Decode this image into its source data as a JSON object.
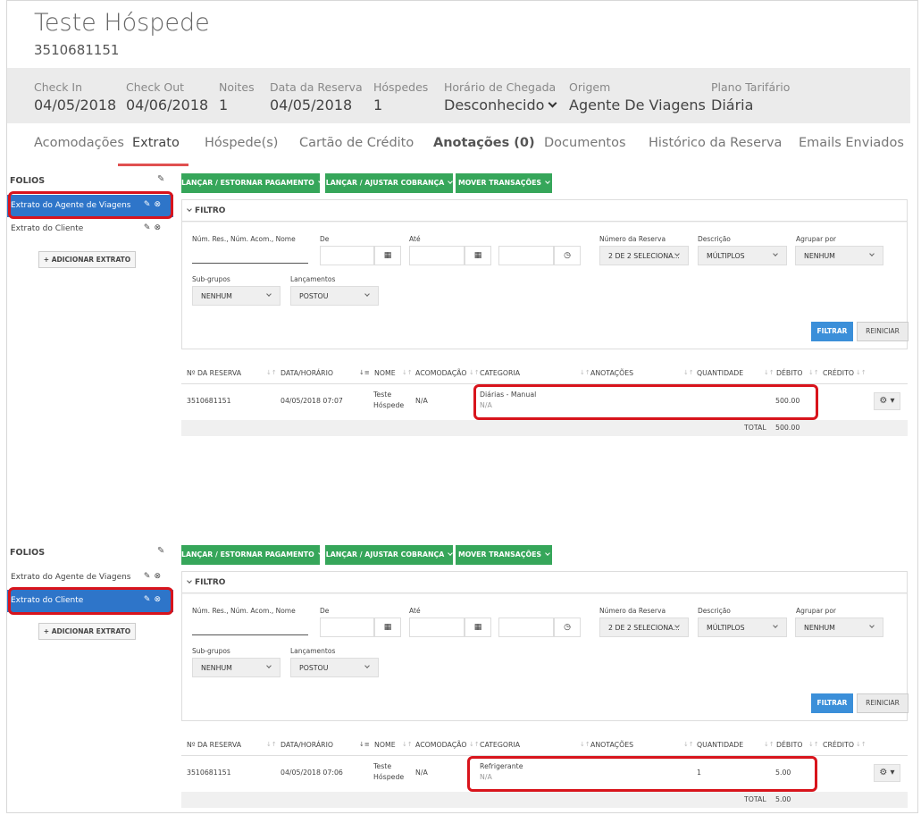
{
  "header": {
    "guest_name": "Teste Hóspede",
    "reservation_id": "3510681151"
  },
  "info": {
    "check_in": {
      "label": "Check In",
      "value": "04/05/2018"
    },
    "check_out": {
      "label": "Check Out",
      "value": "04/06/2018"
    },
    "nights": {
      "label": "Noites",
      "value": "1"
    },
    "booking_date": {
      "label": "Data da Reserva",
      "value": "04/05/2018"
    },
    "guests": {
      "label": "Hóspedes",
      "value": "1"
    },
    "arrival": {
      "label": "Horário de Chegada",
      "value": "Desconhecido"
    },
    "origin": {
      "label": "Origem",
      "value": "Agente De Viagens"
    },
    "rate_plan": {
      "label": "Plano Tarifário",
      "value": "Diária"
    }
  },
  "tabs": [
    "Acomodações",
    "Extrato",
    "Hóspede(s)",
    "Cartão de Crédito",
    "Anotações (0)",
    "Documentos",
    "Histórico da Reserva",
    "Emails Enviados"
  ],
  "sidebar": {
    "title": "FOLIOS",
    "items": [
      "Extrato do Agente de Viagens",
      "Extrato do Cliente"
    ],
    "add_button": "ADICIONAR EXTRATO"
  },
  "actions": {
    "payment": "LANÇAR / ESTORNAR PAGAMENTO",
    "charge": "LANÇAR / AJUSTAR COBRANÇA",
    "move": "MOVER TRANSAÇÕES"
  },
  "filter": {
    "title": "FILTRO",
    "search_label": "Núm. Res., Núm. Acom., Nome",
    "from_label": "De",
    "to_label": "Até",
    "reservation_label": "Número da Reserva",
    "reservation_value": "2 DE 2 SELECIONA...",
    "description_label": "Descrição",
    "description_value": "MÚLTIPLOS",
    "group_label": "Agrupar por",
    "group_value": "NENHUM",
    "subgroups_label": "Sub-grupos",
    "subgroups_value": "NENHUM",
    "entries_label": "Lançamentos",
    "entries_value": "POSTOU",
    "filter_button": "FILTRAR",
    "reset_button": "REINICIAR"
  },
  "table": {
    "columns": [
      "Nº DA RESERVA",
      "DATA/HORÁRIO",
      "NOME",
      "ACOMODAÇÃO",
      "CATEGORIA",
      "ANOTAÇÕES",
      "QUANTIDADE",
      "DÉBITO",
      "CRÉDITO"
    ],
    "total_label": "TOTAL"
  },
  "panel1": {
    "row": {
      "reservation": "3510681151",
      "datetime": "04/05/2018 07:07",
      "name_line1": "Teste",
      "name_line2": "Hóspede",
      "room": "N/A",
      "category": "Diárias - Manual",
      "category_sub": "N/A",
      "quantity": "",
      "debit": "500.00",
      "credit": ""
    },
    "total": "500.00"
  },
  "panel2": {
    "row": {
      "reservation": "3510681151",
      "datetime": "04/05/2018 07:06",
      "name_line1": "Teste",
      "name_line2": "Hóspede",
      "room": "N/A",
      "category": "Refrigerante",
      "category_sub": "N/A",
      "quantity": "1",
      "debit": "5.00",
      "credit": ""
    },
    "total": "5.00"
  },
  "colors": {
    "primary_blue": "#2e75c9",
    "green": "#36a65a",
    "highlight_red": "#d8141c",
    "tab_underline": "#e05050"
  }
}
